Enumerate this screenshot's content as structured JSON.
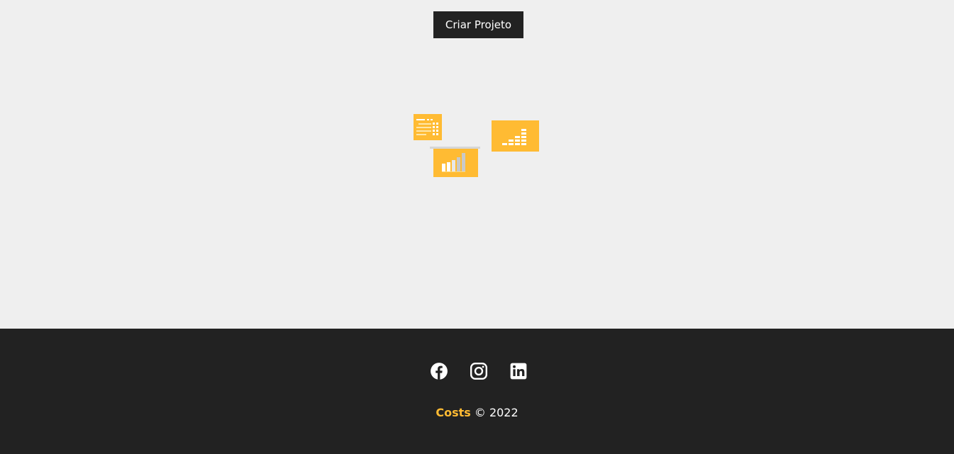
{
  "actions": {
    "create_project_label": "Criar Projeto"
  },
  "illustration": {
    "name": "savings-illustration",
    "accent": "#ffbb33",
    "bar_accent": "#c9c9c9"
  },
  "footer": {
    "social": [
      {
        "name": "facebook-icon"
      },
      {
        "name": "instagram-icon"
      },
      {
        "name": "linkedin-icon"
      }
    ],
    "brand": "Costs",
    "copyright": "© 2022"
  },
  "colors": {
    "background": "#efefef",
    "dark": "#222222",
    "accent": "#ffbb33",
    "text_light": "#ffffff"
  }
}
